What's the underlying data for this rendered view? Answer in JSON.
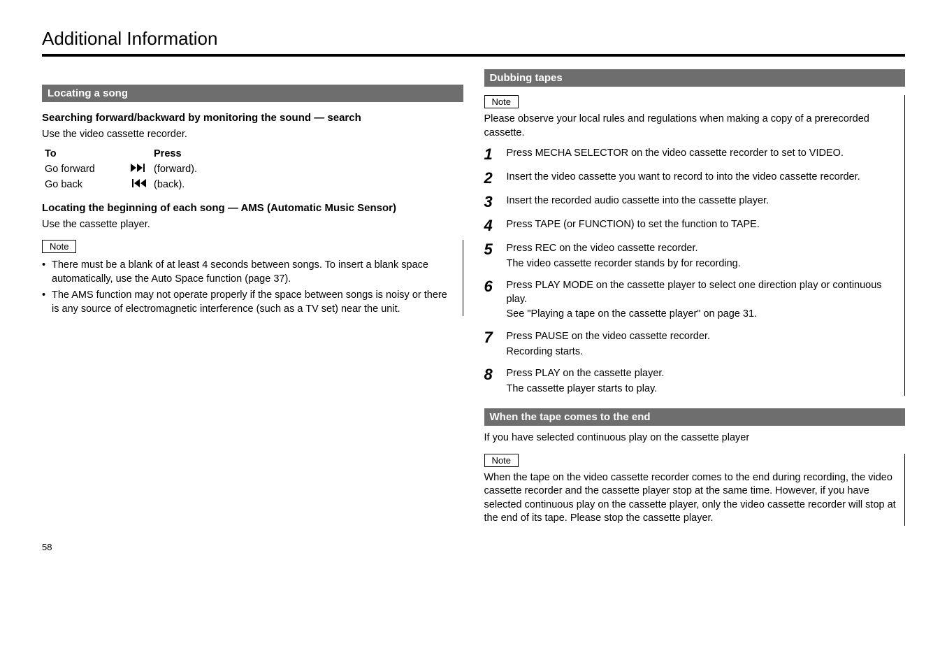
{
  "page": {
    "title": "Additional Information",
    "number": "58"
  },
  "left": {
    "section_header": "Locating a song",
    "search_heading": "Searching forward/backward by monitoring the sound — search",
    "search_text": "Use the video cassette recorder.",
    "table": {
      "h1": "To",
      "h2": "Press",
      "h3": "",
      "rows": [
        {
          "c1": "Go forward",
          "c3": "(forward)."
        },
        {
          "c1": "Go back",
          "c3": "(back)."
        }
      ]
    },
    "locating_heading": "Locating the beginning of each song — AMS (Automatic Music Sensor)",
    "locating_text": "Use the cassette player.",
    "note_label": "Note",
    "notes": [
      "There must be a blank of at least 4 seconds between songs. To insert a blank space automatically, use the Auto Space function (page 37).",
      "The AMS function may not operate properly if the space between songs is noisy or there is any source of electromagnetic interference (such as a TV set) near the unit."
    ]
  },
  "right_top": {
    "section_header": "Dubbing tapes",
    "note_label": "Note",
    "note_text": "Please observe your local rules and regulations when making a copy of a prerecorded cassette.",
    "steps": [
      {
        "n": "1",
        "b": "Press MECHA SELECTOR on the video cassette recorder to set to VIDEO."
      },
      {
        "n": "2",
        "b": "Insert the video cassette you want to record to into the video cassette recorder."
      },
      {
        "n": "3",
        "b": "Insert the recorded audio cassette into the cassette player."
      },
      {
        "n": "4",
        "b": "Press TAPE (or FUNCTION) to set the function to TAPE."
      },
      {
        "n": "5",
        "b": "Press REC on the video cassette recorder.",
        "sub": "The video cassette recorder stands by for recording."
      },
      {
        "n": "6",
        "b": "Press PLAY MODE on the cassette player to select one direction play or continuous play.",
        "sub": "See \"Playing a tape on the cassette player\" on page 31."
      },
      {
        "n": "7",
        "b": "Press PAUSE on the video cassette recorder.",
        "sub": "Recording starts."
      },
      {
        "n": "8",
        "b": "Press PLAY on the cassette player.",
        "sub": "The cassette player starts to play."
      }
    ]
  },
  "right_bottom": {
    "section_header": "When the tape comes to the end",
    "body1": "If you have selected continuous play on the cassette player",
    "note_label": "Note",
    "note_text": "When the tape on the video cassette recorder comes to the end during recording, the video cassette recorder and the cassette player stop at the same time. However, if you have selected continuous play on the cassette player, only the video cassette recorder will stop at the end of its tape. Please stop the cassette player."
  }
}
